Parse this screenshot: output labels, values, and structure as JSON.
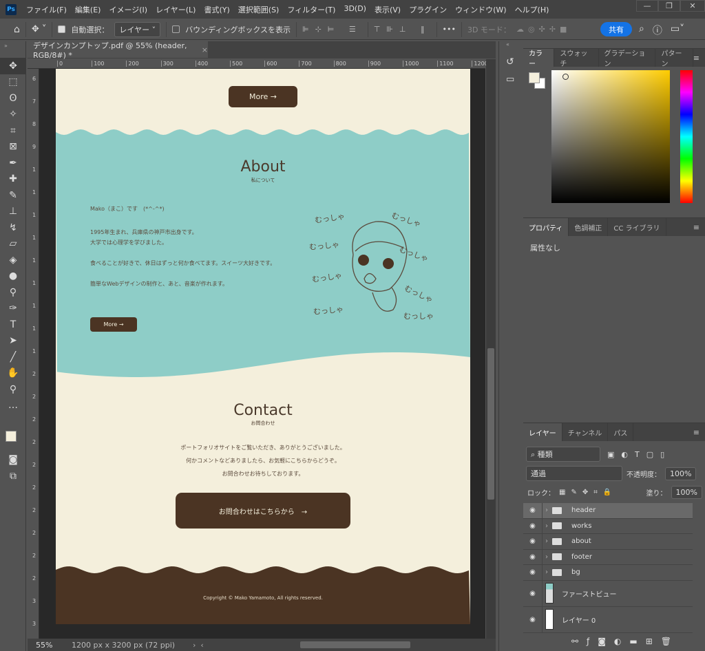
{
  "app": {
    "logo": "Ps",
    "menu": [
      "ファイル(F)",
      "編集(E)",
      "イメージ(I)",
      "レイヤー(L)",
      "書式(Y)",
      "選択範囲(S)",
      "フィルター(T)",
      "3D(D)",
      "表示(V)",
      "プラグイン",
      "ウィンドウ(W)",
      "ヘルプ(H)"
    ],
    "window_buttons": [
      "—",
      "❐",
      "✕"
    ]
  },
  "options": {
    "auto_select_label": "自動選択：",
    "auto_select_checked": true,
    "target": "レイヤー",
    "bounding_box_label": "バウンディングボックスを表示",
    "bounding_box_checked": false,
    "more": "•••",
    "mode_3d": "3D モード：",
    "share": "共有"
  },
  "document": {
    "tab_title": "デザインカンプトップ.pdf @ 55% (header, RGB/8#) *",
    "close": "×",
    "zoom": "55%",
    "info": "1200 px x 3200 px (72 ppi)",
    "ruler_h": [
      "0",
      "100",
      "200",
      "300",
      "400",
      "500",
      "600",
      "700",
      "800",
      "900",
      "1000",
      "1100",
      "1200"
    ],
    "ruler_v": [
      "6",
      "7",
      "8",
      "9",
      "1",
      "1",
      "1",
      "1",
      "1",
      "1",
      "1",
      "1",
      "1",
      "2",
      "2",
      "2",
      "2",
      "2",
      "2",
      "2",
      "2",
      "2",
      "2",
      "3",
      "3"
    ],
    "colors": {
      "cream": "#f4efdc",
      "teal": "#8ecdc7",
      "brown": "#4b3423"
    }
  },
  "page": {
    "top_button": "More →",
    "about": {
      "title": "About",
      "subtitle": "私について",
      "lines": [
        "Mako（まこ）です　(*^-^*)",
        "1995年生まれ、兵庫県の神戸市出身です。",
        "大学では心理学を学びました。",
        "食べることが好きで、休日はずっと何か食べてます。スイーツ大好きです。",
        "簡単なWebデザインの制作と、あと、音楽が作れます。"
      ],
      "button": "More →",
      "doodle_text": [
        "むっしゃ",
        "むっしゃ",
        "むっしゃ",
        "むっしゃ",
        "むっしゃ",
        "むっしゃ",
        "むっしゃ",
        "むっしゃ"
      ]
    },
    "contact": {
      "title": "Contact",
      "subtitle": "お問合わせ",
      "lines": [
        "ポートフォリオサイトをご覧いただき、ありがとうございました。",
        "何かコメントなどありましたら、お気軽にこちらからどうぞ。",
        "お問合わせお待ちしております。"
      ],
      "button": "お問合わせはこちらから　→"
    },
    "footer": {
      "copyright": "Copyright © Mako Yamamoto, All rights reserved."
    }
  },
  "panels": {
    "color": {
      "tabs": [
        "カラー",
        "スウォッチ",
        "グラデーション",
        "パターン"
      ],
      "foreground": "#f4efdc",
      "background": "#ffffff",
      "hue": "#ffcc00"
    },
    "properties": {
      "tabs": [
        "プロパティ",
        "色調補正",
        "CC ライブラリ"
      ],
      "content": "属性なし"
    },
    "layers": {
      "tabs": [
        "レイヤー",
        "チャンネル",
        "パス"
      ],
      "filter": "種類",
      "blend": "通過",
      "opacity_label": "不透明度：",
      "opacity": "100%",
      "lock_label": "ロック：",
      "fill_label": "塗り：",
      "fill": "100%",
      "items": [
        {
          "name": "header",
          "type": "group",
          "selected": true
        },
        {
          "name": "works",
          "type": "group"
        },
        {
          "name": "about",
          "type": "group"
        },
        {
          "name": "footer",
          "type": "group"
        },
        {
          "name": "bg",
          "type": "group"
        },
        {
          "name": "ファーストビュー",
          "type": "smart"
        },
        {
          "name": "レイヤー 0",
          "type": "layer"
        }
      ]
    }
  }
}
